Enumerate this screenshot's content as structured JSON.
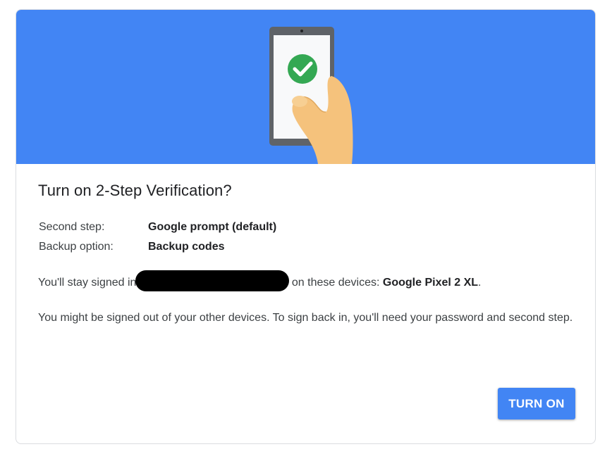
{
  "dialog": {
    "title": "Turn on 2-Step Verification?",
    "rows": [
      {
        "label": "Second step:",
        "value": "Google prompt (default)"
      },
      {
        "label": "Backup option:",
        "value": "Backup codes"
      }
    ],
    "signed_in_prefix": "You'll stay signed in",
    "signed_in_suffix": "on these devices:",
    "device_name": "Google Pixel 2 XL",
    "device_period": ".",
    "signout_warning": "You might be signed out of your other devices. To sign back in, you'll need your password and second step.",
    "turn_on_label": "TURN ON"
  },
  "colors": {
    "hero_bg": "#4285f4",
    "button_bg": "#4285f4",
    "check_green": "#34a853"
  },
  "icons": {
    "illustration": "phone-in-hand-with-checkmark",
    "check": "check-icon"
  }
}
